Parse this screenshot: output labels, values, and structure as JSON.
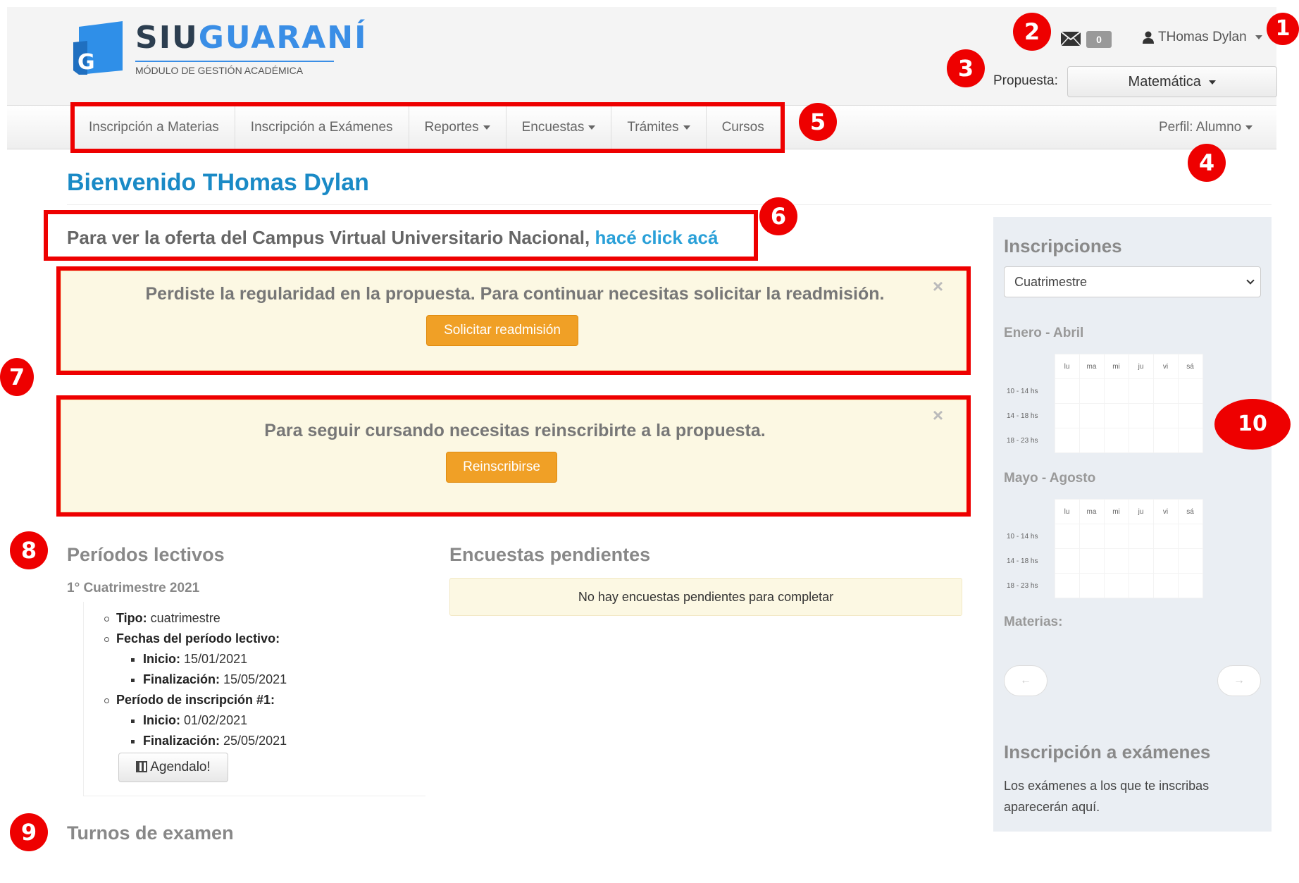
{
  "header": {
    "logo_title_a": "SIU",
    "logo_title_b": "GUARANÍ",
    "logo_letter": "G",
    "logo_subtitle": "MÓDULO DE GESTIÓN ACADÉMICA",
    "mail_count": "0",
    "user_name": "THomas Dylan",
    "propuesta_label": "Propuesta:",
    "propuesta_value": "Matemática"
  },
  "nav": {
    "items": [
      {
        "label": "Inscripción a Materias"
      },
      {
        "label": "Inscripción a Exámenes"
      },
      {
        "label": "Reportes"
      },
      {
        "label": "Encuestas"
      },
      {
        "label": "Trámites"
      },
      {
        "label": "Cursos"
      }
    ],
    "perfil": "Perfil: Alumno"
  },
  "main": {
    "welcome": "Bienvenido THomas Dylan",
    "campus_text": "Para ver la oferta del Campus Virtual Universitario Nacional,",
    "campus_link": "hacé click acá",
    "alerts": [
      {
        "message": "Perdiste la regularidad en la propuesta. Para continuar necesitas solicitar la readmisión.",
        "button": "Solicitar readmisión",
        "close": "×"
      },
      {
        "message": "Para seguir cursando necesitas reinscribirte a la propuesta.",
        "button": "Reinscribirse",
        "close": "×"
      }
    ],
    "periodos": {
      "title": "Períodos lectivos",
      "period_name": "1° Cuatrimestre 2021",
      "tipo_label": "Tipo:",
      "tipo_value": "cuatrimestre",
      "fechas_label": "Fechas del período lectivo:",
      "inicio_label": "Inicio:",
      "inicio_value": "15/01/2021",
      "fin_label": "Finalización:",
      "fin_value": "15/05/2021",
      "insc_label": "Período de inscripción #1:",
      "insc_inicio_label": "Inicio:",
      "insc_inicio_value": "01/02/2021",
      "insc_fin_label": "Finalización:",
      "insc_fin_value": "25/05/2021",
      "agendalo": "Agendalo!"
    },
    "encuestas": {
      "title": "Encuestas pendientes",
      "empty": "No hay encuestas pendientes para completar"
    },
    "turnos_title": "Turnos de examen"
  },
  "sidebar": {
    "title": "Inscripciones",
    "select_value": "Cuatrimestre",
    "calendars": [
      {
        "title": "Enero - Abril",
        "days": [
          "lu",
          "ma",
          "mi",
          "ju",
          "vi",
          "sá"
        ],
        "rows": [
          "10 - 14 hs",
          "14 - 18 hs",
          "18 - 23 hs"
        ]
      },
      {
        "title": "Mayo - Agosto",
        "days": [
          "lu",
          "ma",
          "mi",
          "ju",
          "vi",
          "sá"
        ],
        "rows": [
          "10 - 14 hs",
          "14 - 18 hs",
          "18 - 23 hs"
        ]
      }
    ],
    "materias_label": "Materias:",
    "prev": "←",
    "next": "→",
    "examenes_title": "Inscripción a exámenes",
    "examenes_text": "Los exámenes a los que te inscribas aparecerán aquí."
  },
  "annotations": {
    "markers": [
      "1",
      "2",
      "3",
      "4",
      "5",
      "6",
      "7",
      "8",
      "9",
      "10"
    ],
    "marker_color": "#ee0000"
  }
}
